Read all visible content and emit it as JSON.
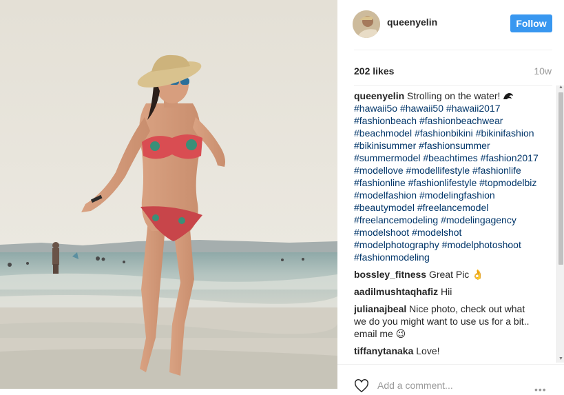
{
  "post": {
    "photo_alt": "",
    "author": "queenyelin",
    "follow_label": "Follow",
    "likes": "202 likes",
    "time_ago": "10w",
    "caption_user": "queenyelin",
    "caption_text": "Strolling on the water!",
    "hashtags": [
      "#hawaii5o",
      "#hawaii50",
      "#hawaii2017",
      "#fashionbeach",
      "#fashionbeachwear",
      "#beachmodel",
      "#fashionbikini",
      "#bikinifashion",
      "#bikinisummer",
      "#fashionsummer",
      "#summermodel",
      "#beachtimes",
      "#fashion2017",
      "#modellove",
      "#modellifestyle",
      "#fashionlife",
      "#fashionline",
      "#fashionlifestyle",
      "#topmodelbiz",
      "#modelfashion",
      "#modelingfashion",
      "#beautymodel",
      "#freelancemodel",
      "#freelancemodeling",
      "#modelingagency",
      "#modelshoot",
      "#modelshot",
      "#modelphotography",
      "#modelphotoshoot",
      "#fashionmodeling"
    ],
    "comments": [
      {
        "user": "bossley_fitness",
        "text": "Great Pic 👌"
      },
      {
        "user": "aadilmushtaqhafiz",
        "text": "Hii"
      },
      {
        "user": "julianajbeal",
        "text": "Nice photo, check out what we do you might want to use us for a bit.. email me 😉"
      },
      {
        "user": "tiffanytanaka",
        "text": "Love!"
      }
    ],
    "add_comment_placeholder": "Add a comment...",
    "more_label": "•••"
  },
  "icons": {
    "caption_emoji": "wave-icon",
    "heart": "heart-icon",
    "more": "more-options-icon"
  },
  "colors": {
    "follow": "#3897f0",
    "hashtag": "#003569",
    "muted": "#999999"
  }
}
